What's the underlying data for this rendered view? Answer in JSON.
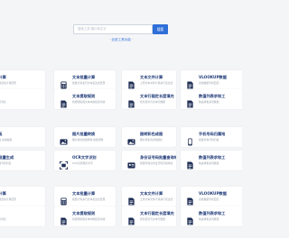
{
  "search": {
    "placeholder": "搜索工具 图片转文字",
    "button": "搜索",
    "all_tools_link": "· 全部工具功能 ·"
  },
  "cards": [
    {
      "title": "数据计算",
      "desc": "常用函数自动计算结果"
    },
    {
      "title": "文本批量计算",
      "desc": "批量计算多行文本表达式结果"
    },
    {
      "title": "文本文件计算",
      "desc": "上传文本文件计算多行表达式"
    },
    {
      "title": "VLOOKUP数据",
      "desc": "表格数据查找匹配"
    },
    {
      "title": "对比",
      "desc": "文本差异对比"
    },
    {
      "title": "文本提取规则",
      "desc": "按规则提取文本中的指定内容"
    },
    {
      "title": "文本行固定长度填充",
      "desc": "按长度补齐文本行数据"
    },
    {
      "title": "数值列表求和工",
      "desc": "快速求和多列数据"
    },
    {
      "title": "图帖板",
      "desc": "图片粘贴 在线编辑"
    },
    {
      "title": "图片批量转换",
      "desc": "图片格式批量转换 批量调整"
    },
    {
      "title": "图转彩色成图",
      "desc": "图片转彩色风格图片"
    },
    {
      "title": "手机号码归属地",
      "desc": "批量查询号码归属"
    },
    {
      "title": "号码批量生成",
      "desc": "批量生成号码列表"
    },
    {
      "title": "OCR文字识别",
      "desc": "OCR识别图片文字"
    },
    {
      "title": "身份证号码批量查询地址",
      "desc": "批量查询身份证号码归属地址"
    },
    {
      "title": "数值列表求和工",
      "desc": "快速求和多列数据"
    },
    {
      "title": "数据计算",
      "desc": "常用函数自动计算结果"
    },
    {
      "title": "文本批量计算",
      "desc": "批量计算多行文本表达式结果"
    },
    {
      "title": "文本文件计算",
      "desc": "上传文本文件计算多行表达式"
    },
    {
      "title": "VLOOKUP数据",
      "desc": "表格数据查找匹配"
    },
    {
      "title": "对比",
      "desc": "文本差异对比"
    },
    {
      "title": "文本提取规则",
      "desc": "按规则提取文本中的指定内容"
    },
    {
      "title": "文本行固定长度填充",
      "desc": "按长度补齐文本行数据"
    },
    {
      "title": "数值列表求和工",
      "desc": "快速求和多列数据"
    }
  ],
  "colors": {
    "accent": "#2f6fd8",
    "title": "#1f3a78",
    "icon": "#1f2f55"
  }
}
